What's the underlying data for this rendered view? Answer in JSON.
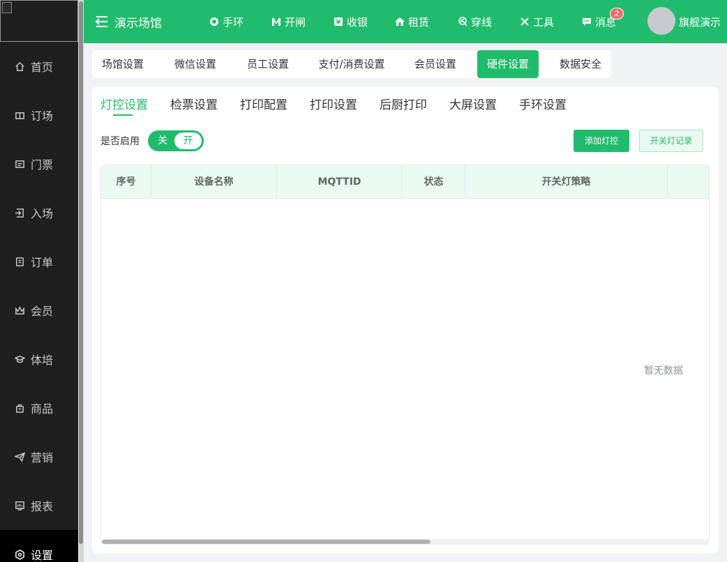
{
  "sidebar": {
    "items": [
      {
        "label": "首页",
        "icon": "home-icon"
      },
      {
        "label": "订场",
        "icon": "court-icon"
      },
      {
        "label": "门票",
        "icon": "ticket-icon"
      },
      {
        "label": "入场",
        "icon": "enter-icon"
      },
      {
        "label": "订单",
        "icon": "order-icon"
      },
      {
        "label": "会员",
        "icon": "crown-icon"
      },
      {
        "label": "体培",
        "icon": "training-icon"
      },
      {
        "label": "商品",
        "icon": "bag-icon"
      },
      {
        "label": "营销",
        "icon": "paper-plane-icon"
      },
      {
        "label": "报表",
        "icon": "report-icon"
      },
      {
        "label": "设置",
        "icon": "settings-icon"
      }
    ]
  },
  "header": {
    "brand": "演示场馆",
    "nav": [
      {
        "label": "手环",
        "icon": "wristband-icon"
      },
      {
        "label": "开闸",
        "icon": "gate-icon"
      },
      {
        "label": "收银",
        "icon": "cashier-icon"
      },
      {
        "label": "租赁",
        "icon": "rent-icon"
      },
      {
        "label": "穿线",
        "icon": "stringing-icon"
      },
      {
        "label": "工具",
        "icon": "tools-icon"
      },
      {
        "label": "消息",
        "icon": "message-icon"
      }
    ],
    "message_badge": "2",
    "username": "旗舰演示",
    "accent_color": "#20bc6c"
  },
  "setting_tabs": [
    "场馆设置",
    "微信设置",
    "员工设置",
    "支付/消费设置",
    "会员设置",
    "硬件设置",
    "数据安全"
  ],
  "sub_tabs": [
    "灯控设置",
    "检票设置",
    "打印配置",
    "打印设置",
    "后厨打印",
    "大屏设置",
    "手环设置"
  ],
  "controls": {
    "enable_label": "是否启用",
    "switch_off": "关",
    "switch_on": "开",
    "add_button": "添加灯控",
    "record_button": "开关灯记录"
  },
  "table": {
    "columns": [
      "序号",
      "设备名称",
      "MQTTID",
      "状态",
      "开关灯策略"
    ],
    "empty_text": "暂无数据"
  }
}
